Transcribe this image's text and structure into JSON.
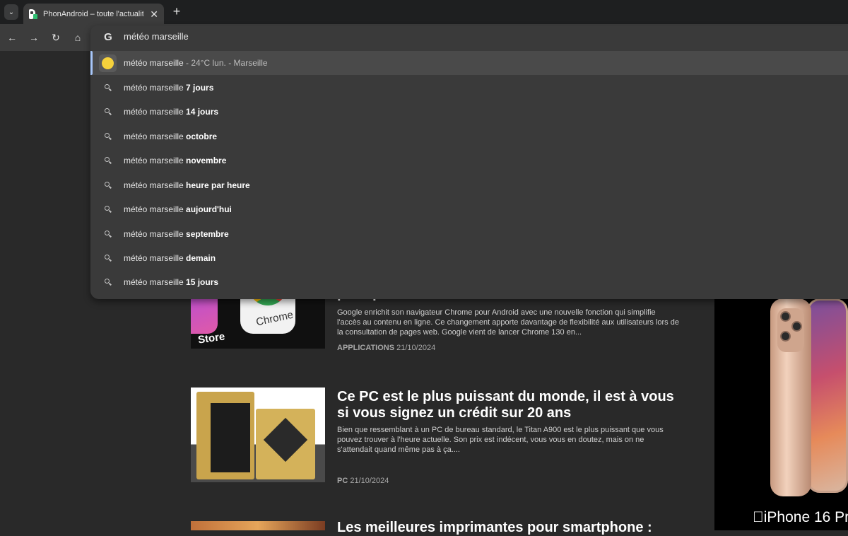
{
  "browser": {
    "tab_title": "PhonAndroid – toute l'actualité",
    "tab_close": "✕",
    "new_tab": "+",
    "tab_list": "⌄",
    "nav": {
      "back": "←",
      "forward": "→",
      "reload": "↻",
      "home": "⌂"
    }
  },
  "omnibox": {
    "query": "météo marseille",
    "engine_icon": "G",
    "suggestions": [
      {
        "base": "météo marseille",
        "bold": "",
        "extra": " - 24°C lun. - Marseille",
        "icon": "weather-sun-icon"
      },
      {
        "base": "météo marseille ",
        "bold": "7 jours",
        "extra": "",
        "icon": "search-icon"
      },
      {
        "base": "météo marseille ",
        "bold": "14 jours",
        "extra": "",
        "icon": "search-icon"
      },
      {
        "base": "météo marseille ",
        "bold": "octobre",
        "extra": "",
        "icon": "search-icon"
      },
      {
        "base": "météo marseille ",
        "bold": "novembre",
        "extra": "",
        "icon": "search-icon"
      },
      {
        "base": "météo marseille ",
        "bold": "heure par heure",
        "extra": "",
        "icon": "search-icon"
      },
      {
        "base": "météo marseille ",
        "bold": "aujourd'hui",
        "extra": "",
        "icon": "search-icon"
      },
      {
        "base": "météo marseille ",
        "bold": "septembre",
        "extra": "",
        "icon": "search-icon"
      },
      {
        "base": "météo marseille ",
        "bold": "demain",
        "extra": "",
        "icon": "search-icon"
      },
      {
        "base": "météo marseille ",
        "bold": "15 jours",
        "extra": "",
        "icon": "search-icon"
      }
    ]
  },
  "articles": [
    {
      "title": "pratique",
      "desc": "Google enrichit son navigateur Chrome pour Android avec une nouvelle fonction qui simplifie l'accès au contenu en ligne. Ce changement apporte davantage de flexibilité aux utilisateurs lors de la consultation de pages web. Google vient de lancer Chrome 130 en...",
      "category": "APPLICATIONS",
      "date": "21/10/2024",
      "thumb_text_1": "Chrome",
      "thumb_text_2": "Store"
    },
    {
      "title": "Ce PC est le plus puissant du monde, il est à vous si vous signez un crédit sur 20 ans",
      "desc": "Bien que ressemblant à un PC de bureau standard, le Titan A900 est le plus puissant que vous pouvez trouver à l'heure actuelle. Son prix est indécent, vous vous en doutez, mais on ne s'attendait quand même pas à ça....",
      "category": "PC",
      "date": "21/10/2024"
    },
    {
      "title": "Les meilleures imprimantes pour smartphone :"
    }
  ],
  "ad": {
    "text": "iPhone 16 Pr"
  }
}
